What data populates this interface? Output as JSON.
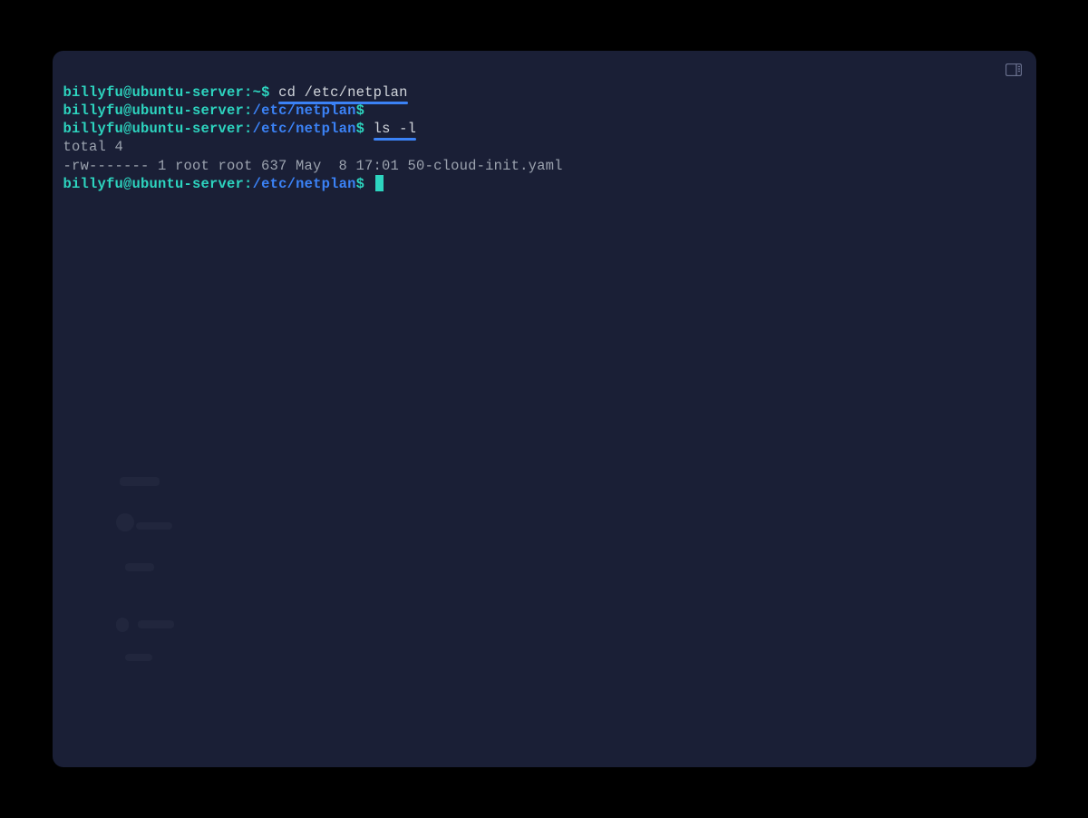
{
  "window": {
    "panel_icon": "panel-icon"
  },
  "prompt": {
    "userhost": "billyfu@ubuntu-server",
    "home_path": "~",
    "netplan_path": "/etc/netplan",
    "dollar": "$"
  },
  "commands": {
    "cd": "cd /etc/netplan",
    "ls": "ls -l"
  },
  "output": {
    "total": "total 4",
    "listing": "-rw------- 1 root root 637 May  8 17:01 50-cloud-init.yaml"
  }
}
